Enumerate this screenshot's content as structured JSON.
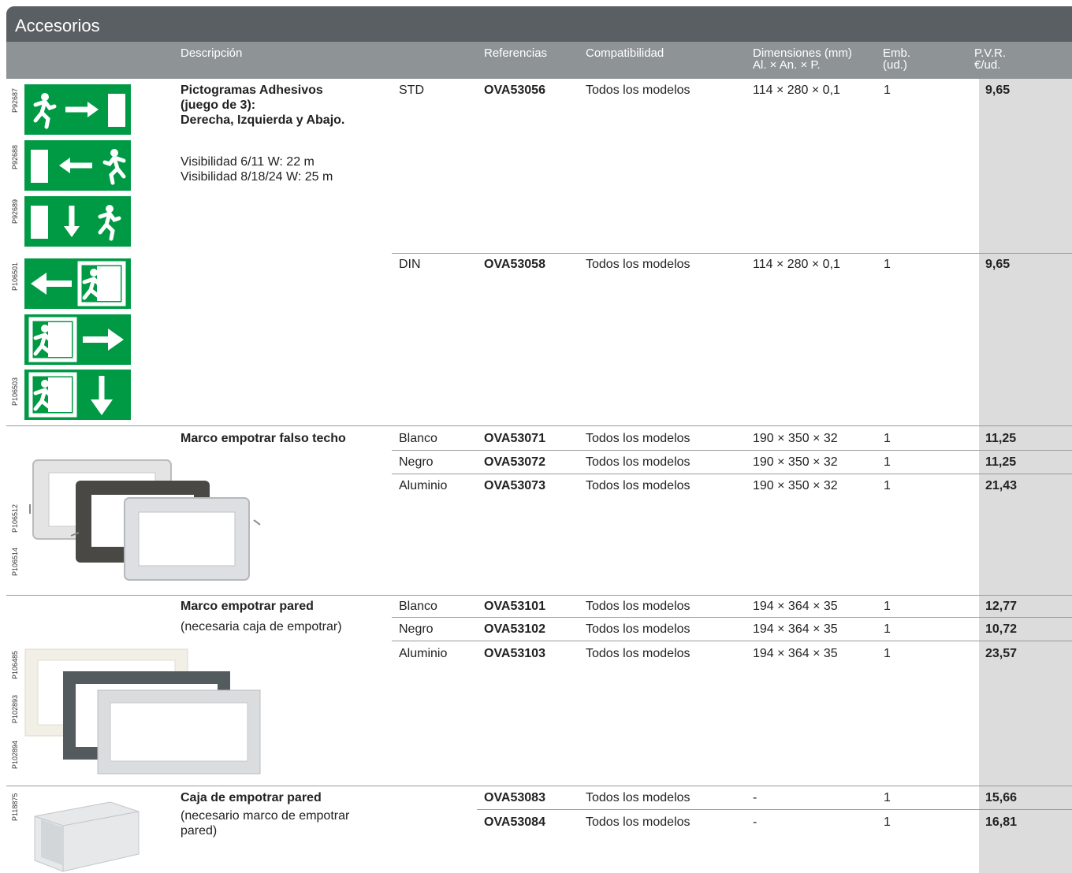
{
  "title": "Accesorios",
  "headers": {
    "descripcion": "Descripción",
    "referencias": "Referencias",
    "compatibilidad": "Compatibilidad",
    "dimensiones_1": "Dimensiones (mm)",
    "dimensiones_2": "Al. × An. × P.",
    "emb_1": "Emb.",
    "emb_2": "(ud.)",
    "pvr_1": "P.V.R.",
    "pvr_2": "€/ud."
  },
  "image_codes": {
    "s1": "P92687",
    "s2": "P92688",
    "s3": "P92689",
    "s4": "P106501",
    "s6": "P106503",
    "m1": "P106512",
    "m2": "P106514",
    "p1": "P106485",
    "p2": "P102893",
    "p3": "P102894",
    "c1": "P118875"
  },
  "sections": {
    "pictogramas": {
      "title_1": "Pictogramas Adhesivos",
      "title_2": "(juego de 3):",
      "title_3": "Derecha, Izquierda y Abajo.",
      "vis_1": "Visibilidad 6/11 W: 22 m",
      "vis_2": "Visibilidad 8/18/24 W: 25 m",
      "rows": [
        {
          "variant": "STD",
          "ref": "OVA53056",
          "compat": "Todos los modelos",
          "dim": "114 × 280 × 0,1",
          "emb": "1",
          "price": "9,65"
        },
        {
          "variant": "DIN",
          "ref": "OVA53058",
          "compat": "Todos los modelos",
          "dim": "114 × 280 × 0,1",
          "emb": "1",
          "price": "9,65"
        }
      ]
    },
    "falso_techo": {
      "title": "Marco empotrar falso techo",
      "rows": [
        {
          "variant": "Blanco",
          "ref": "OVA53071",
          "compat": "Todos los modelos",
          "dim": "190 × 350 × 32",
          "emb": "1",
          "price": "11,25"
        },
        {
          "variant": "Negro",
          "ref": "OVA53072",
          "compat": "Todos los modelos",
          "dim": "190 × 350 × 32",
          "emb": "1",
          "price": "11,25"
        },
        {
          "variant": "Aluminio",
          "ref": "OVA53073",
          "compat": "Todos los modelos",
          "dim": "190 × 350 × 32",
          "emb": "1",
          "price": "21,43"
        }
      ]
    },
    "pared": {
      "title": "Marco empotrar pared",
      "subtitle": "(necesaria caja de empotrar)",
      "rows": [
        {
          "variant": "Blanco",
          "ref": "OVA53101",
          "compat": "Todos los modelos",
          "dim": "194 × 364 × 35",
          "emb": "1",
          "price": "12,77"
        },
        {
          "variant": "Negro",
          "ref": "OVA53102",
          "compat": "Todos los modelos",
          "dim": "194 × 364 × 35",
          "emb": "1",
          "price": "10,72"
        },
        {
          "variant": "Aluminio",
          "ref": "OVA53103",
          "compat": "Todos los modelos",
          "dim": "194 × 364 × 35",
          "emb": "1",
          "price": "23,57"
        }
      ]
    },
    "caja": {
      "title": "Caja de empotrar pared",
      "subtitle_1": "(necesario marco de empotrar",
      "subtitle_2": "pared)",
      "rows": [
        {
          "ref": "OVA53083",
          "compat": "Todos los modelos",
          "dim": "-",
          "emb": "1",
          "price": "15,66"
        },
        {
          "ref": "OVA53084",
          "compat": "Todos los modelos",
          "dim": "-",
          "emb": "1",
          "price": "16,81"
        }
      ]
    }
  }
}
